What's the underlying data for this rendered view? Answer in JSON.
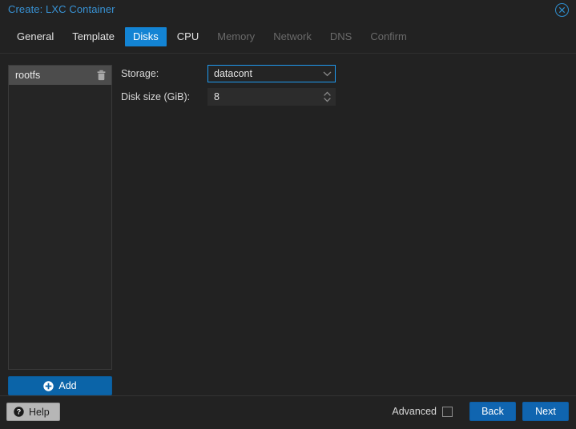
{
  "window": {
    "title": "Create: LXC Container",
    "close_icon": "close-circle-icon"
  },
  "tabs": [
    {
      "label": "General",
      "state": "enabled"
    },
    {
      "label": "Template",
      "state": "enabled"
    },
    {
      "label": "Disks",
      "state": "active"
    },
    {
      "label": "CPU",
      "state": "enabled"
    },
    {
      "label": "Memory",
      "state": "disabled"
    },
    {
      "label": "Network",
      "state": "disabled"
    },
    {
      "label": "DNS",
      "state": "disabled"
    },
    {
      "label": "Confirm",
      "state": "disabled"
    }
  ],
  "disk_list": {
    "items": [
      {
        "label": "rootfs",
        "selected": true,
        "delete_icon": "trash-icon"
      }
    ],
    "add_button": {
      "label": "Add",
      "icon": "plus-circle-icon"
    }
  },
  "form": {
    "storage": {
      "label": "Storage:",
      "value": "datacont",
      "placeholder": "Select storage",
      "icon": "chevron-down-icon",
      "focused": true
    },
    "disk_size": {
      "label": "Disk size (GiB):",
      "value": "8",
      "placeholder": "",
      "icon": "spinner-updown-icon",
      "focused": false
    }
  },
  "footer": {
    "help_label": "Help",
    "help_icon": "question-circle-icon",
    "advanced_label": "Advanced",
    "advanced_checked": false,
    "back_label": "Back",
    "next_label": "Next"
  },
  "colors": {
    "accent_blue": "#1384d4",
    "title_blue": "#3892d4",
    "focus_blue": "#1f9af0",
    "button_blue": "#1065b0",
    "add_blue": "#0b64a8",
    "window_bg": "#222222",
    "panel_bg": "#252525",
    "row_selected": "#4c4c4c"
  }
}
